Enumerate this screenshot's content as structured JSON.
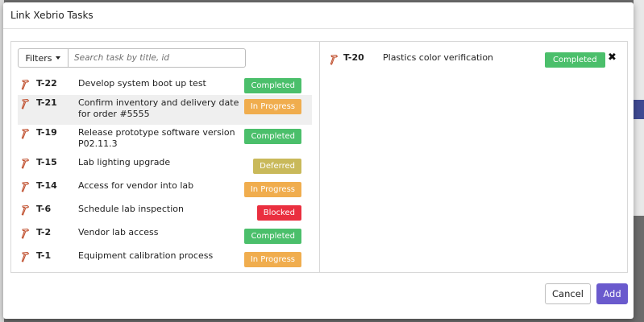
{
  "modal": {
    "title": "Link Xebrio Tasks"
  },
  "filters": {
    "label": "Filters",
    "search_placeholder": "Search task by title, id",
    "search_value": ""
  },
  "tasks": [
    {
      "id": "T-22",
      "title": "Develop system boot up test",
      "status": "Completed",
      "status_color": "#4bbf6b"
    },
    {
      "id": "T-21",
      "title": "Confirm inventory and delivery date for order #5555",
      "status": "In Progress",
      "status_color": "#f0ad4e"
    },
    {
      "id": "T-19",
      "title": "Release prototype software version P02.11.3",
      "status": "Completed",
      "status_color": "#4bbf6b"
    },
    {
      "id": "T-15",
      "title": "Lab lighting upgrade",
      "status": "Deferred",
      "status_color": "#c9b95a"
    },
    {
      "id": "T-14",
      "title": "Access for vendor into lab",
      "status": "In Progress",
      "status_color": "#f0ad4e"
    },
    {
      "id": "T-6",
      "title": "Schedule lab inspection",
      "status": "Blocked",
      "status_color": "#ea2f3f"
    },
    {
      "id": "T-2",
      "title": "Vendor lab access",
      "status": "Completed",
      "status_color": "#4bbf6b"
    },
    {
      "id": "T-1",
      "title": "Equipment calibration process",
      "status": "In Progress",
      "status_color": "#f0ad4e"
    }
  ],
  "selected": [
    {
      "id": "T-20",
      "title": "Plastics color verification",
      "status": "Completed",
      "status_color": "#4bbf6b",
      "remove_icon": "close-icon"
    }
  ],
  "footer": {
    "cancel_label": "Cancel",
    "add_label": "Add",
    "add_color": "#6a5acd"
  },
  "icons": {
    "task": "hammer-icon",
    "filter_caret": "caret-down-icon",
    "remove": "close-icon"
  }
}
